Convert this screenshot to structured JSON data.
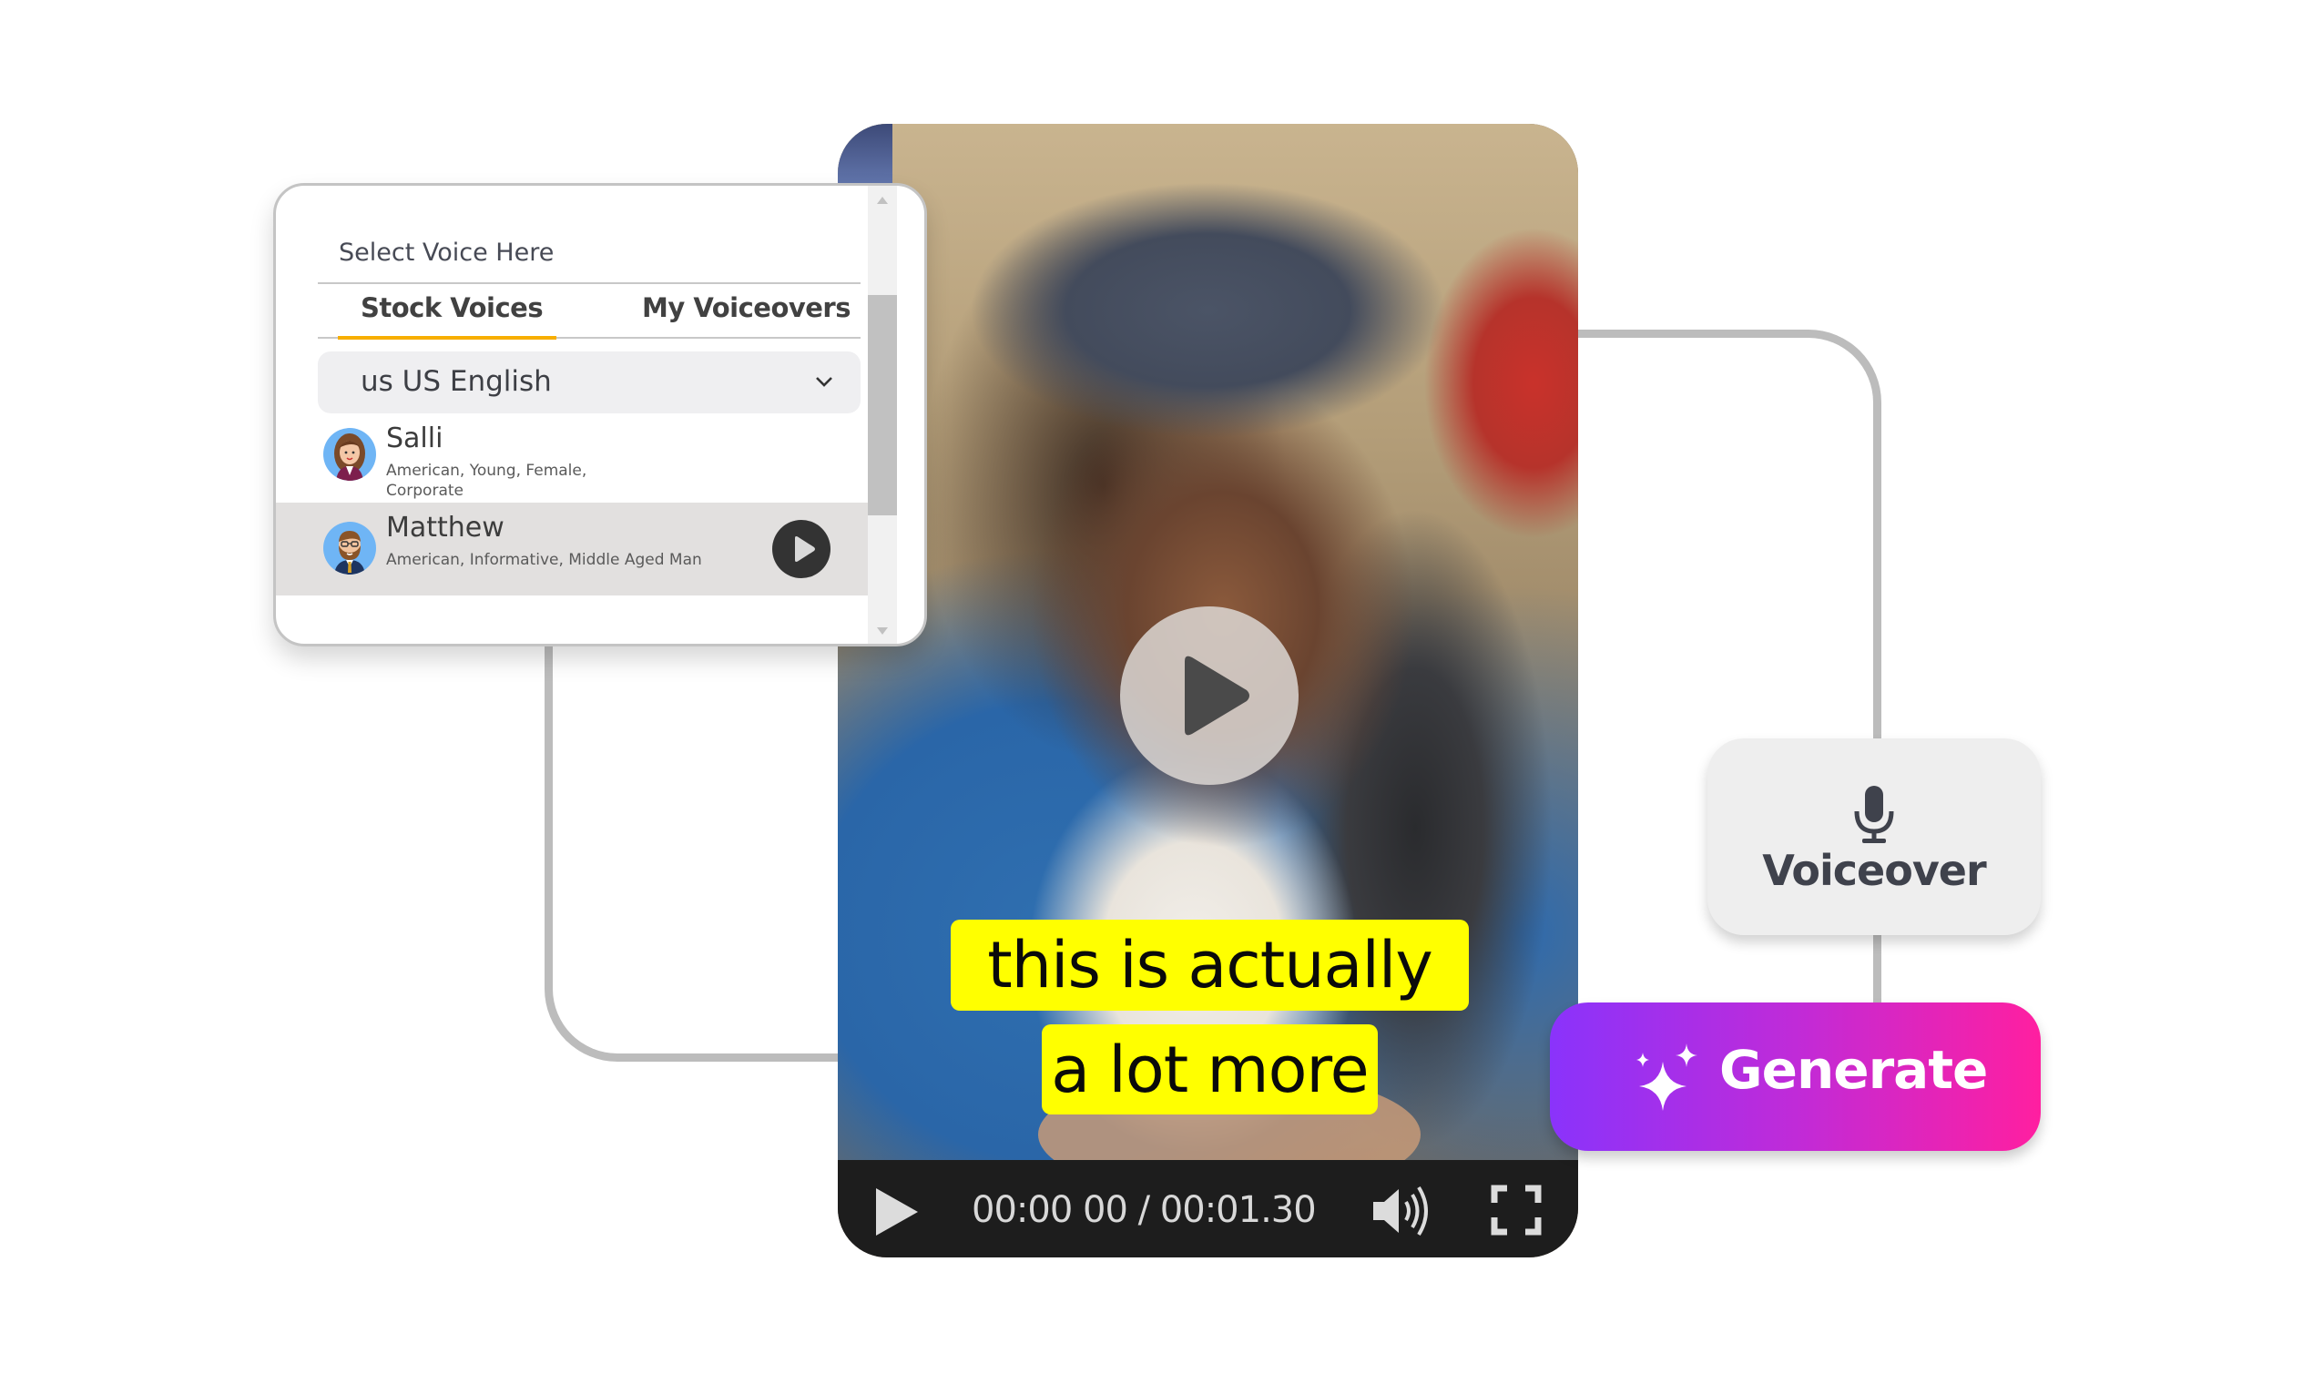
{
  "voice_panel": {
    "title": "Select Voice Here",
    "tabs": [
      {
        "label": "Stock Voices",
        "active": true
      },
      {
        "label": "My Voiceovers",
        "active": false
      }
    ],
    "language_select": {
      "value": "us US English",
      "icon": "chevron-down-icon"
    },
    "voices": [
      {
        "name": "Salli",
        "description": "American, Young, Female, Corporate",
        "selected": false
      },
      {
        "name": "Matthew",
        "description": "American, Informative, Middle Aged Man",
        "selected": true,
        "action_icon": "play-icon"
      }
    ],
    "accent_color": "#f7ae00"
  },
  "video": {
    "captions": [
      "this is actually",
      "a lot more"
    ],
    "caption_color": "#ffff00",
    "center_icon": "play-icon",
    "controls": {
      "play_icon": "play-icon",
      "time": "00:00 00 / 00:01.30",
      "volume_icon": "volume-icon",
      "fullscreen_icon": "fullscreen-icon"
    }
  },
  "voiceover_card": {
    "icon": "microphone-icon",
    "label": "Voiceover"
  },
  "generate_button": {
    "icon": "sparkle-icon",
    "label": "Generate",
    "gradient": [
      "#8a33fb",
      "#ff1fa0"
    ]
  }
}
